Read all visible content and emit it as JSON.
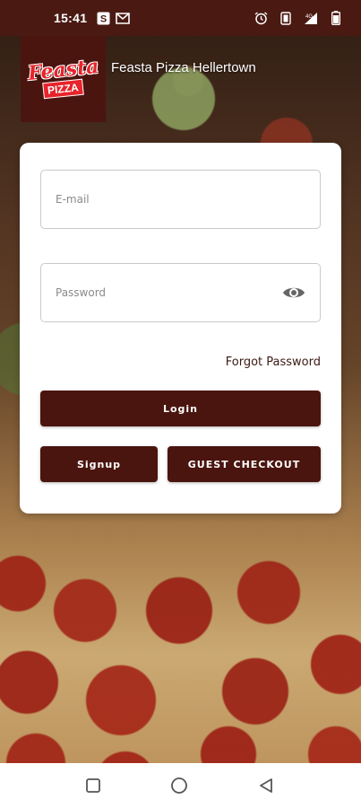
{
  "status_bar": {
    "time": "15:41",
    "left_icons": [
      "s-app-icon",
      "gmail-icon"
    ],
    "right_icons": [
      "alarm-icon",
      "vibrate-icon",
      "signal-icon",
      "battery-icon"
    ]
  },
  "header": {
    "logo_script": "Feasta",
    "logo_sub": "PIZZA",
    "store_name": "Feasta Pizza Hellertown"
  },
  "login_form": {
    "email_placeholder": "E-mail",
    "email_value": "",
    "password_placeholder": "Password",
    "password_value": "",
    "forgot_label": "Forgot Password",
    "login_label": "Login",
    "signup_label": "Signup",
    "guest_label": "GUEST CHECKOUT"
  },
  "nav": {
    "recents": "square-icon",
    "home": "circle-icon",
    "back": "triangle-back-icon"
  },
  "colors": {
    "primary": "#4b150f",
    "status_bar": "#4a1a12",
    "logo_red": "#e8232b"
  }
}
